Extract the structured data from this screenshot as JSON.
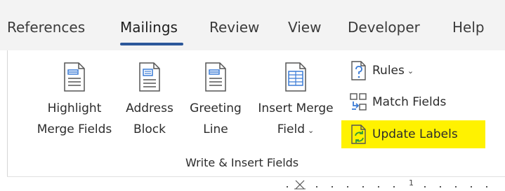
{
  "tabs": {
    "references": "References",
    "mailings": "Mailings",
    "review": "Review",
    "view": "View",
    "developer": "Developer",
    "help": "Help"
  },
  "group": {
    "label": "Write & Insert Fields"
  },
  "buttons": {
    "highlight": {
      "line1": "Highlight",
      "line2": "Merge Fields",
      "icon": "document-lines-icon"
    },
    "address": {
      "line1": "Address",
      "line2": "Block",
      "icon": "address-block-icon"
    },
    "greeting": {
      "line1": "Greeting",
      "line2": "Line",
      "icon": "greeting-line-icon"
    },
    "insert_merge": {
      "line1": "Insert Merge",
      "line2": "Field",
      "chevron": "⌄",
      "icon": "insert-merge-field-icon"
    },
    "rules": {
      "label": "Rules",
      "chevron": "⌄",
      "icon": "rules-icon"
    },
    "match_fields": {
      "label": "Match Fields",
      "icon": "match-fields-icon"
    },
    "update_labels": {
      "label": "Update Labels",
      "icon": "update-labels-icon",
      "highlight_color": "#fff200"
    }
  },
  "ruler": {
    "number": "1"
  },
  "colors": {
    "accent": "#2b579a",
    "highlight": "#fff200",
    "icon_blue": "#3a7bd5",
    "icon_green": "#2e9b3a"
  }
}
